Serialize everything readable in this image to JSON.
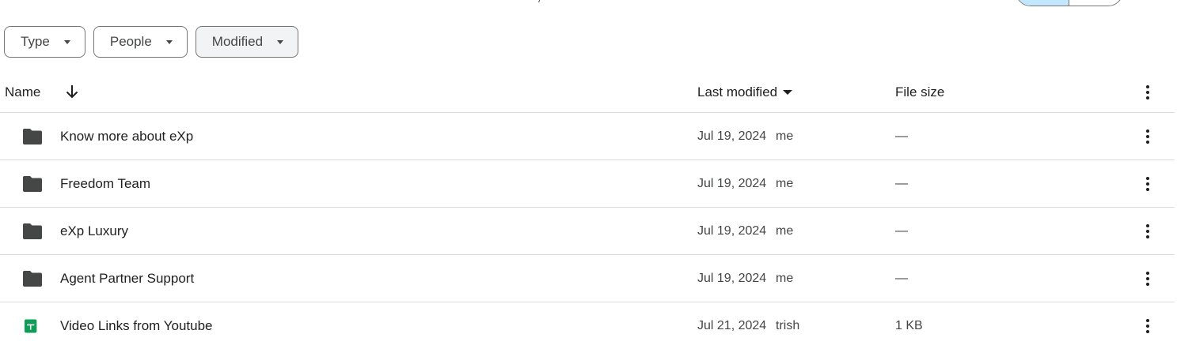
{
  "filters": [
    {
      "label": "Type",
      "active": false
    },
    {
      "label": "People",
      "active": false
    },
    {
      "label": "Modified",
      "active": true
    }
  ],
  "table": {
    "headers": {
      "name": "Name",
      "last_modified": "Last modified",
      "file_size": "File size"
    },
    "sort": {
      "column": "name",
      "direction": "down-arrow-icon"
    },
    "rows": [
      {
        "icon": "folder-icon",
        "name": "Know more about eXp",
        "date": "Jul 19, 2024",
        "owner": "me",
        "size": "—"
      },
      {
        "icon": "folder-icon",
        "name": "Freedom Team",
        "date": "Jul 19, 2024",
        "owner": "me",
        "size": "—"
      },
      {
        "icon": "folder-icon",
        "name": "eXp Luxury",
        "date": "Jul 19, 2024",
        "owner": "me",
        "size": "—"
      },
      {
        "icon": "folder-icon",
        "name": "Agent Partner Support",
        "date": "Jul 19, 2024",
        "owner": "me",
        "size": "—"
      },
      {
        "icon": "google-sheets-icon",
        "name": "Video Links from Youtube",
        "date": "Jul 21, 2024",
        "owner": "trish",
        "size": "1 KB"
      }
    ]
  },
  "colors": {
    "folder": "#444746",
    "sheets": "#0f9d58",
    "toggle_active": "#c2e7ff",
    "divider": "#dadce0"
  }
}
